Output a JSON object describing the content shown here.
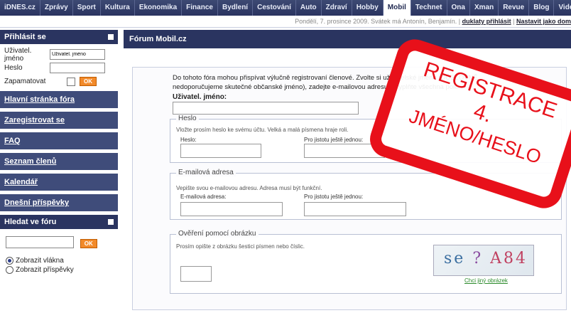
{
  "topnav": {
    "items": [
      "iDNES.cz",
      "Zprávy",
      "Sport",
      "Kultura",
      "Ekonomika",
      "Finance",
      "Bydlení",
      "Cestování",
      "Auto",
      "Zdraví",
      "Hobby",
      "Mobil",
      "Technet",
      "Ona",
      "Xman",
      "Revue",
      "Blog",
      "Video"
    ],
    "active_index": 11
  },
  "subbar": {
    "text": "Pondělí, 7. prosince 2009. Svátek má Antonín, Benjamín. |",
    "link1": "duklaty přihlásit",
    "link2": "Nastavit jako dom"
  },
  "sidebar": {
    "login_title": "Přihlásit se",
    "username_label": "Uživatel. jméno",
    "username_value": "Uživatel. jméno",
    "password_label": "Heslo",
    "remember_label": "Zapamatovat",
    "ok_label": "OK",
    "links": [
      "Hlavní stránka fóra",
      "Zaregistrovat se",
      "FAQ",
      "Seznam členů",
      "Kalendář",
      "Dnešní příspěvky"
    ],
    "search_title": "Hledat ve fóru",
    "search_ok": "OK",
    "radio1": "Zobrazit vlákna",
    "radio2": "Zobrazit příspěvky"
  },
  "main": {
    "title": "Fórum Mobil.cz",
    "intro_line1": "Do tohoto fóra mohou přispívat výlučně registrovaní členové. Zvolte si uživatelské jméno (DŮSLOVNĚ",
    "intro_line2": "nedoporučujeme skutečné občanské jméno), zadejte e-mailovou adresu a vyplňte všechna pole.",
    "username_label": "Uživatel. jméno:",
    "password_section": {
      "legend": "Heslo",
      "desc": "Vložte prosím heslo ke svému účtu. Velká a malá písmena hraje roli.",
      "field1": "Heslo:",
      "field2": "Pro jistotu ještě jednou:"
    },
    "email_section": {
      "legend": "E-mailová adresa",
      "desc": "Vepište svou e-mailovou adresu. Adresa musí být funkční.",
      "field1": "E-mailová adresa:",
      "field2": "Pro jistotu ještě jednou:"
    },
    "captcha_section": {
      "legend": "Ověření pomocí obrázku",
      "desc": "Prosím opište z obrázku šestici písmen nebo číslic.",
      "image_text": [
        "se",
        "?",
        "A84"
      ],
      "link": "Chci jiný obrázek"
    }
  },
  "stamp": {
    "line1": "REGISTRACE",
    "line2": "4.",
    "line3": "JMÉNO/HESLO",
    "color": "#e8101a"
  }
}
